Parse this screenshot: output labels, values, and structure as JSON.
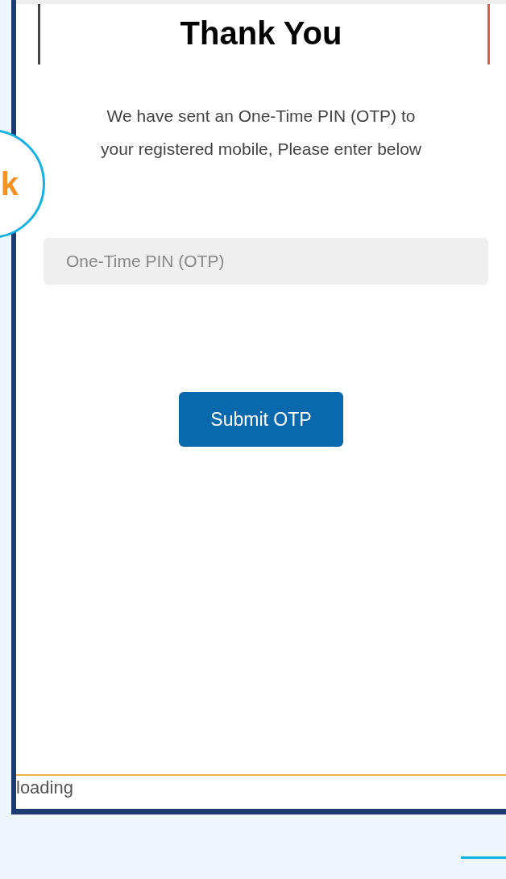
{
  "page": {
    "title": "Thank You",
    "message": "We have sent an One-Time PIN (OTP) to your registered mobile, Please enter below",
    "otp_field": {
      "placeholder": "One-Time PIN (OTP)"
    },
    "submit_button": "Submit OTP"
  },
  "status_text": "loading",
  "speech_bubble": {
    "text": "k"
  }
}
